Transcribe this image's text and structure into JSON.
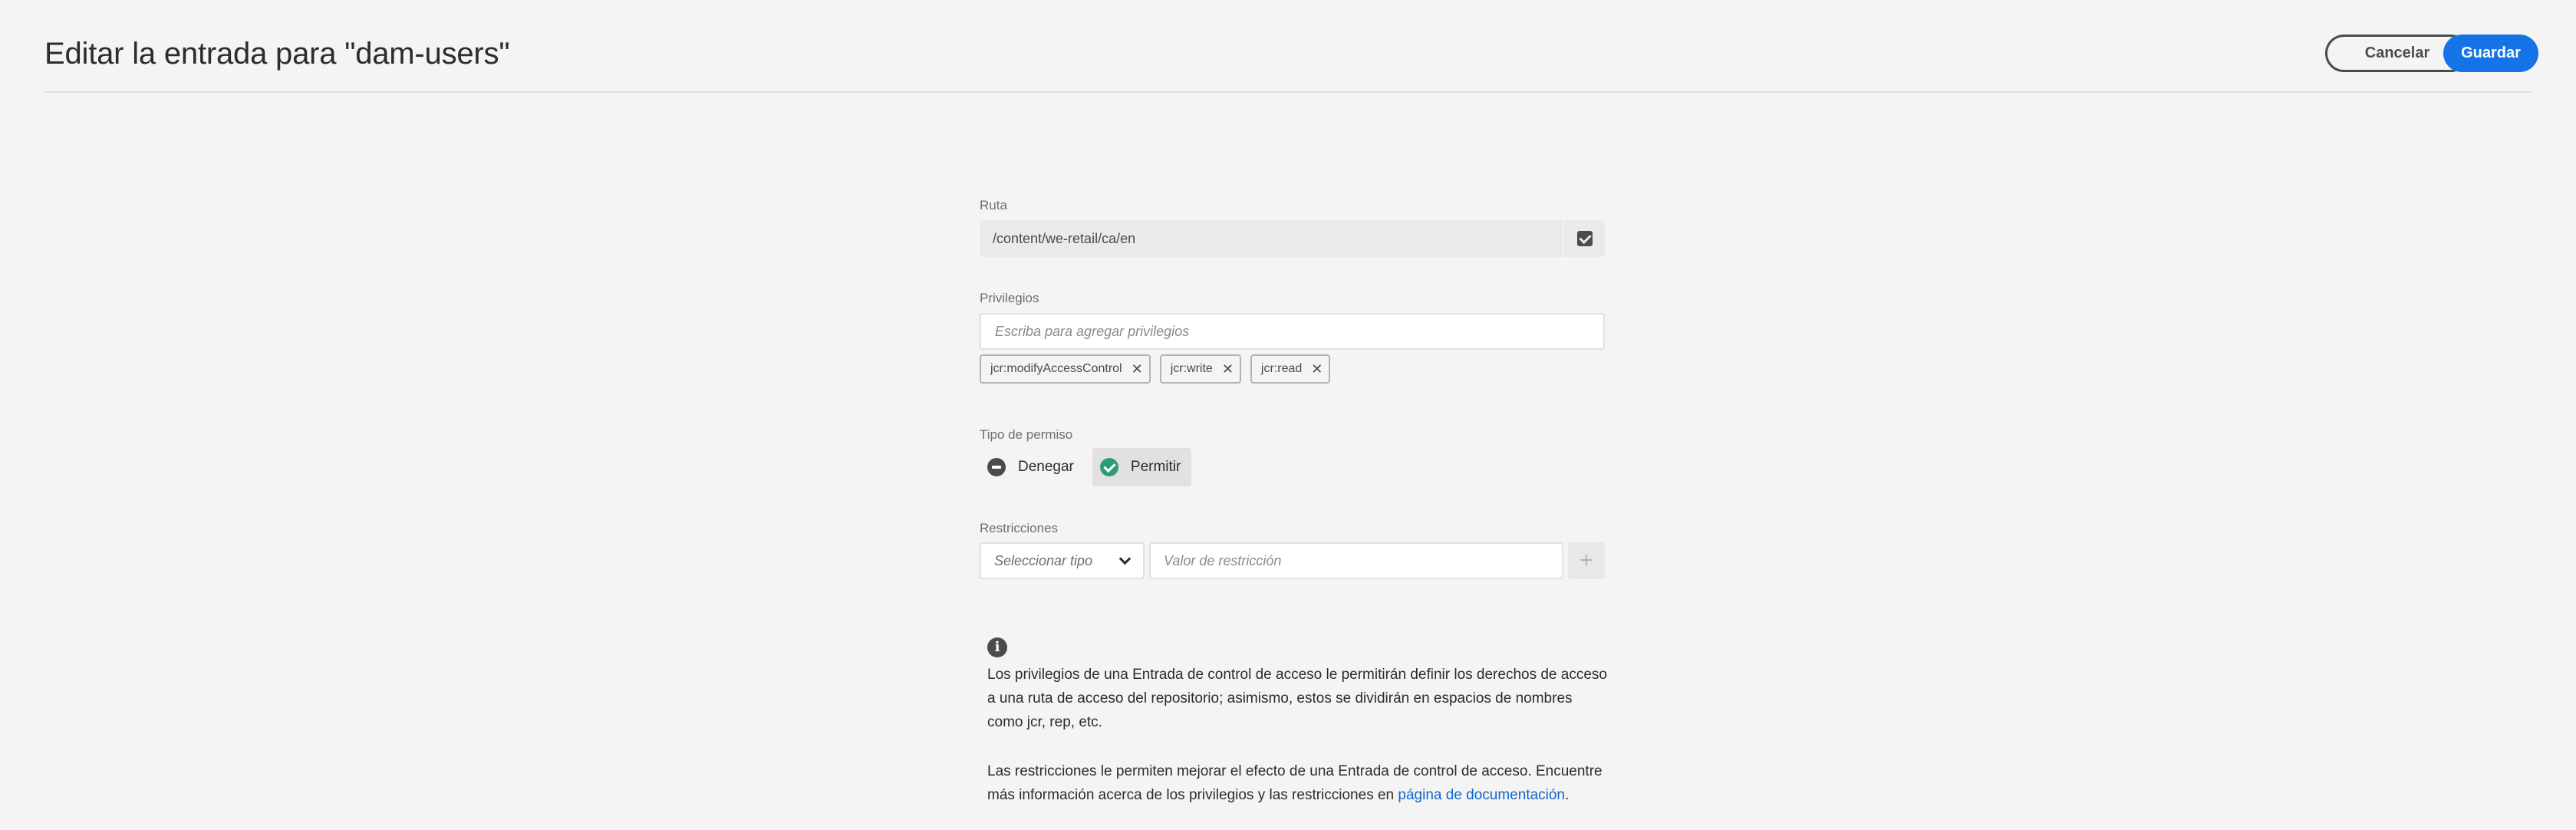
{
  "header": {
    "title": "Editar la entrada para \"dam-users\"",
    "cancel_label": "Cancelar",
    "save_label": "Guardar"
  },
  "path": {
    "label": "Ruta",
    "value": "/content/we-retail/ca/en",
    "browse_icon": "checkbox-icon"
  },
  "privileges": {
    "label": "Privilegios",
    "placeholder": "Escriba para agregar privilegios",
    "tags": [
      "jcr:modifyAccessControl",
      "jcr:write",
      "jcr:read"
    ]
  },
  "permission_type": {
    "label": "Tipo de permiso",
    "options": [
      {
        "label": "Denegar",
        "icon": "remove-circle-icon",
        "selected": false
      },
      {
        "label": "Permitir",
        "icon": "checkmark-circle-icon",
        "selected": true
      }
    ]
  },
  "restrictions": {
    "label": "Restricciones",
    "type_placeholder": "Seleccionar tipo",
    "value_placeholder": "Valor de restricción",
    "add_icon": "plus-icon"
  },
  "help": {
    "icon": "info-icon",
    "paragraph1": "Los privilegios de una Entrada de control de acceso le permitirán definir los derechos de acceso a una ruta de acceso del repositorio; asimismo, estos se dividirán en espacios de nombres como jcr, rep, etc.",
    "paragraph2_text": "Las restricciones le permiten mejorar el efecto de una Entrada de control de acceso. Encuentre más información acerca de los privilegios y las restricciones en ",
    "paragraph2_link": "página de documentación",
    "paragraph2_end": "."
  },
  "colors": {
    "accent": "#1473e6",
    "allow": "#2d9d78",
    "background": "#f4f4f4"
  }
}
